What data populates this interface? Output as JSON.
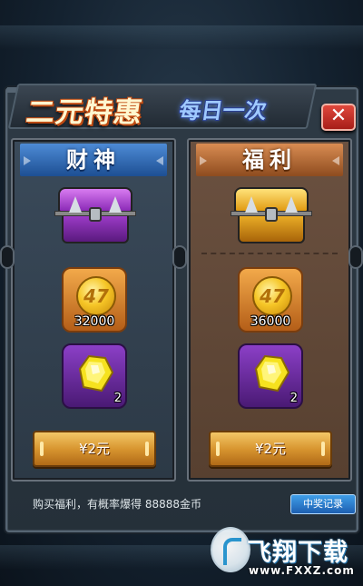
{
  "header": {
    "title": "二元特惠",
    "subtitle": "每日一次",
    "close_label": "✕"
  },
  "offers": [
    {
      "name": "财神",
      "theme": "blue",
      "chest_color": "#a43fd0",
      "coin_icon": "coin-icon",
      "coin_amount": "32000",
      "gem_icon": "yellow-gem-icon",
      "gem_count": "2",
      "price_label": "¥2元"
    },
    {
      "name": "福利",
      "theme": "brown",
      "chest_color": "#f2b629",
      "coin_icon": "coin-icon",
      "coin_amount": "36000",
      "gem_icon": "yellow-gem-icon",
      "gem_count": "2",
      "price_label": "¥2元"
    }
  ],
  "footer": {
    "note": "购买福利，有概率爆得   88888金币",
    "record_button": "中奖记录"
  },
  "watermark": {
    "title": "飞翔下载",
    "url": "www.FXXZ.com"
  },
  "colors": {
    "accent_orange": "#c04b12",
    "close_red": "#d23a30",
    "button_gold": "#d89630",
    "record_blue": "#2a7ad0"
  }
}
